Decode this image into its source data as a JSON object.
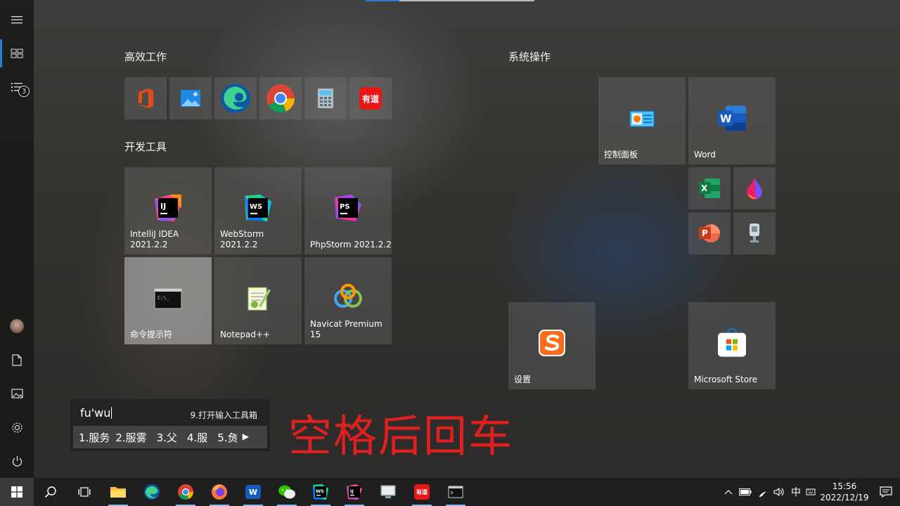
{
  "groups": {
    "efficient": "高效工作",
    "dev": "开发工具",
    "system": "系统操作"
  },
  "tiles": {
    "intellij": "IntelliJ IDEA\n2021.2.2",
    "webstorm": "WebStorm 2021.2.2",
    "phpstorm": "PhpStorm 2021.2.2",
    "cmd": "命令提示符",
    "notepadpp": "Notepad++",
    "navicat": "Navicat Premium 15",
    "control_panel": "控制面板",
    "word": "Word",
    "settings": "设置",
    "store": "Microsoft Store"
  },
  "rail": {
    "badge": "3"
  },
  "ime": {
    "input": "fu'wu",
    "tool": "9.打开输入工具箱",
    "candidates": [
      "1.服务",
      "2.服雾",
      "3.父",
      "4.服",
      "5.负"
    ]
  },
  "overlay_text": "空格后回车",
  "tray": {
    "ime_lang": "中",
    "time": "15:56",
    "date": "2022/12/19"
  },
  "colors": {
    "accent": "#2a7bd4",
    "overlay": "#e02020"
  }
}
